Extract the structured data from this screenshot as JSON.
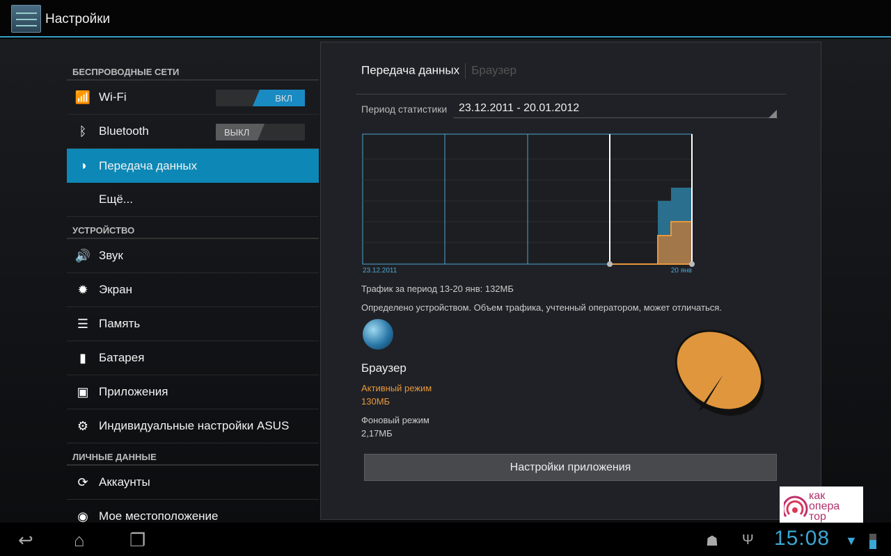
{
  "header": {
    "title": "Настройки",
    "icon": "settings-sliders-icon"
  },
  "sidebar": {
    "sections": [
      {
        "title": "БЕСПРОВОДНЫЕ СЕТИ"
      },
      {
        "title": "УСТРОЙСТВО"
      },
      {
        "title": "ЛИЧНЫЕ ДАННЫЕ"
      }
    ],
    "items": [
      {
        "label": "Wi-Fi",
        "icon": "wifi-icon",
        "toggle": "ВКЛ"
      },
      {
        "label": "Bluetooth",
        "icon": "bluetooth-icon",
        "toggle": "ВЫКЛ"
      },
      {
        "label": "Передача данных",
        "icon": "data-usage-icon",
        "selected": true
      },
      {
        "label": "Ещё..."
      },
      {
        "label": "Звук",
        "icon": "speaker-icon"
      },
      {
        "label": "Экран",
        "icon": "brightness-icon"
      },
      {
        "label": "Память",
        "icon": "storage-icon"
      },
      {
        "label": "Батарея",
        "icon": "battery-icon"
      },
      {
        "label": "Приложения",
        "icon": "apps-icon"
      },
      {
        "label": "Индивидуальные настройки ASUS",
        "icon": "gear-icon"
      },
      {
        "label": "Аккаунты",
        "icon": "sync-icon"
      },
      {
        "label": "Мое местоположение",
        "icon": "location-icon"
      }
    ]
  },
  "panel": {
    "tabs": [
      "Передача данных",
      "Браузер"
    ],
    "period_label": "Период статистики",
    "period_value": "23.12.2011 - 20.01.2012",
    "chart": {
      "start_label": "23.12.2011",
      "end_label": "20 янв"
    },
    "traffic": "Трафик за период 13-20 янв: 132МБ",
    "note": "Определено устройством. Объем трафика, учтенный оператором, может отличаться.",
    "app_name": "Браузер",
    "foreground_label": "Активный режим",
    "foreground_value": "130МБ",
    "background_label": "Фоновый режим",
    "background_value": "2,17МБ",
    "app_settings_button": "Настройки приложения",
    "colors": {
      "foreground": "#e8983c",
      "total": "#2a6f8e",
      "accent": "#0d88b6"
    }
  },
  "status": {
    "time": "15:08"
  },
  "watermark": {
    "text": "как опера тор ру"
  }
}
